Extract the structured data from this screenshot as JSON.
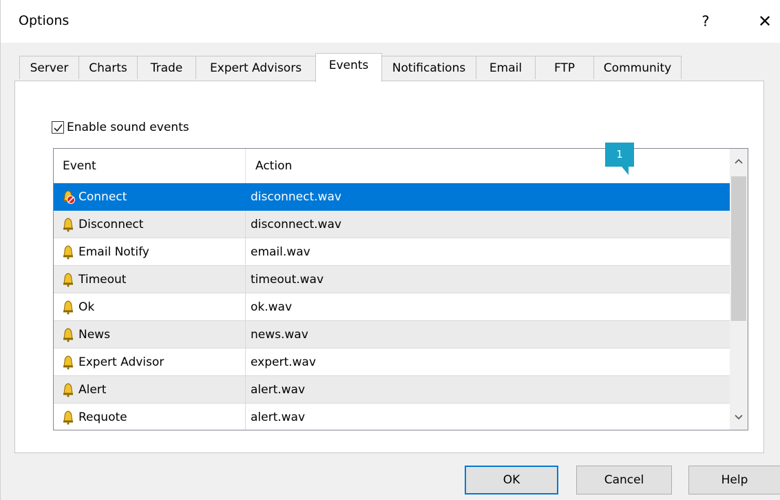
{
  "window": {
    "title": "Options",
    "help_glyph": "?",
    "close_glyph": "✕"
  },
  "tabs": [
    {
      "label": "Server",
      "active": false
    },
    {
      "label": "Charts",
      "active": false
    },
    {
      "label": "Trade",
      "active": false
    },
    {
      "label": "Expert Advisors",
      "active": false
    },
    {
      "label": "Events",
      "active": true
    },
    {
      "label": "Notifications",
      "active": false
    },
    {
      "label": "Email",
      "active": false
    },
    {
      "label": "FTP",
      "active": false
    },
    {
      "label": "Community",
      "active": false
    }
  ],
  "events": {
    "enable_label": "Enable sound events",
    "enabled": true,
    "columns": {
      "event": "Event",
      "action": "Action"
    },
    "rows": [
      {
        "event": "Connect",
        "action": "disconnect.wav",
        "selected": true,
        "icon": "bell-disabled-icon"
      },
      {
        "event": "Disconnect",
        "action": "disconnect.wav",
        "icon": "bell-icon"
      },
      {
        "event": "Email Notify",
        "action": "email.wav",
        "icon": "bell-icon"
      },
      {
        "event": "Timeout",
        "action": "timeout.wav",
        "icon": "bell-icon"
      },
      {
        "event": "Ok",
        "action": "ok.wav",
        "icon": "bell-icon"
      },
      {
        "event": "News",
        "action": "news.wav",
        "icon": "bell-icon"
      },
      {
        "event": "Expert Advisor",
        "action": "expert.wav",
        "icon": "bell-icon"
      },
      {
        "event": "Alert",
        "action": "alert.wav",
        "icon": "bell-icon"
      },
      {
        "event": "Requote",
        "action": "alert.wav",
        "icon": "bell-icon"
      }
    ]
  },
  "callout": {
    "label": "1"
  },
  "buttons": {
    "ok": "OK",
    "cancel": "Cancel",
    "help": "Help"
  },
  "colors": {
    "selection": "#0078d7",
    "callout": "#1ba1c5",
    "bell": "#f2c12e",
    "disabled_badge": "#e02020"
  }
}
